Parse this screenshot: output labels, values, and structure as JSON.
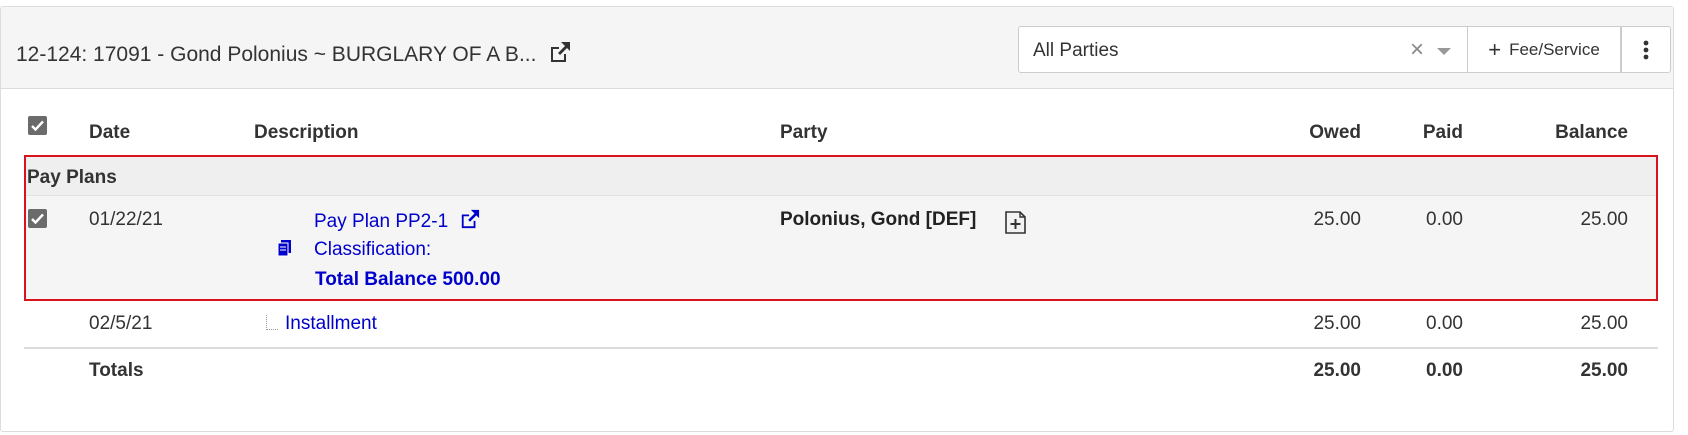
{
  "header": {
    "case_title": "12-124: 17091 - Gond Polonius ~ BURGLARY OF A B...",
    "party_filter": {
      "value": "All Parties"
    },
    "fee_button_label": "Fee/Service"
  },
  "table": {
    "columns": {
      "date": "Date",
      "description": "Description",
      "party": "Party",
      "owed": "Owed",
      "paid": "Paid",
      "balance": "Balance"
    },
    "group": {
      "label": "Pay Plans",
      "row": {
        "date": "01/22/21",
        "pay_plan_link": "Pay Plan PP2-1",
        "classification": "Classification:",
        "total_balance": "Total Balance 500.00",
        "party": "Polonius, Gond [DEF]",
        "owed": "25.00",
        "paid": "0.00",
        "balance": "25.00"
      }
    },
    "installment": {
      "date": "02/5/21",
      "label": "Installment",
      "owed": "25.00",
      "paid": "0.00",
      "balance": "25.00"
    },
    "totals": {
      "label": "Totals",
      "owed": "25.00",
      "paid": "0.00",
      "balance": "25.00"
    }
  },
  "colors": {
    "link": "#0000cc",
    "highlight_border": "#d9131e",
    "header_bg": "#f5f5f5"
  },
  "icons": [
    "external-link-icon",
    "clear-icon",
    "chevron-down-icon",
    "plus-icon",
    "kebab-menu-icon",
    "checkbox-icon",
    "documents-icon",
    "add-note-icon",
    "tree-connector-icon"
  ]
}
